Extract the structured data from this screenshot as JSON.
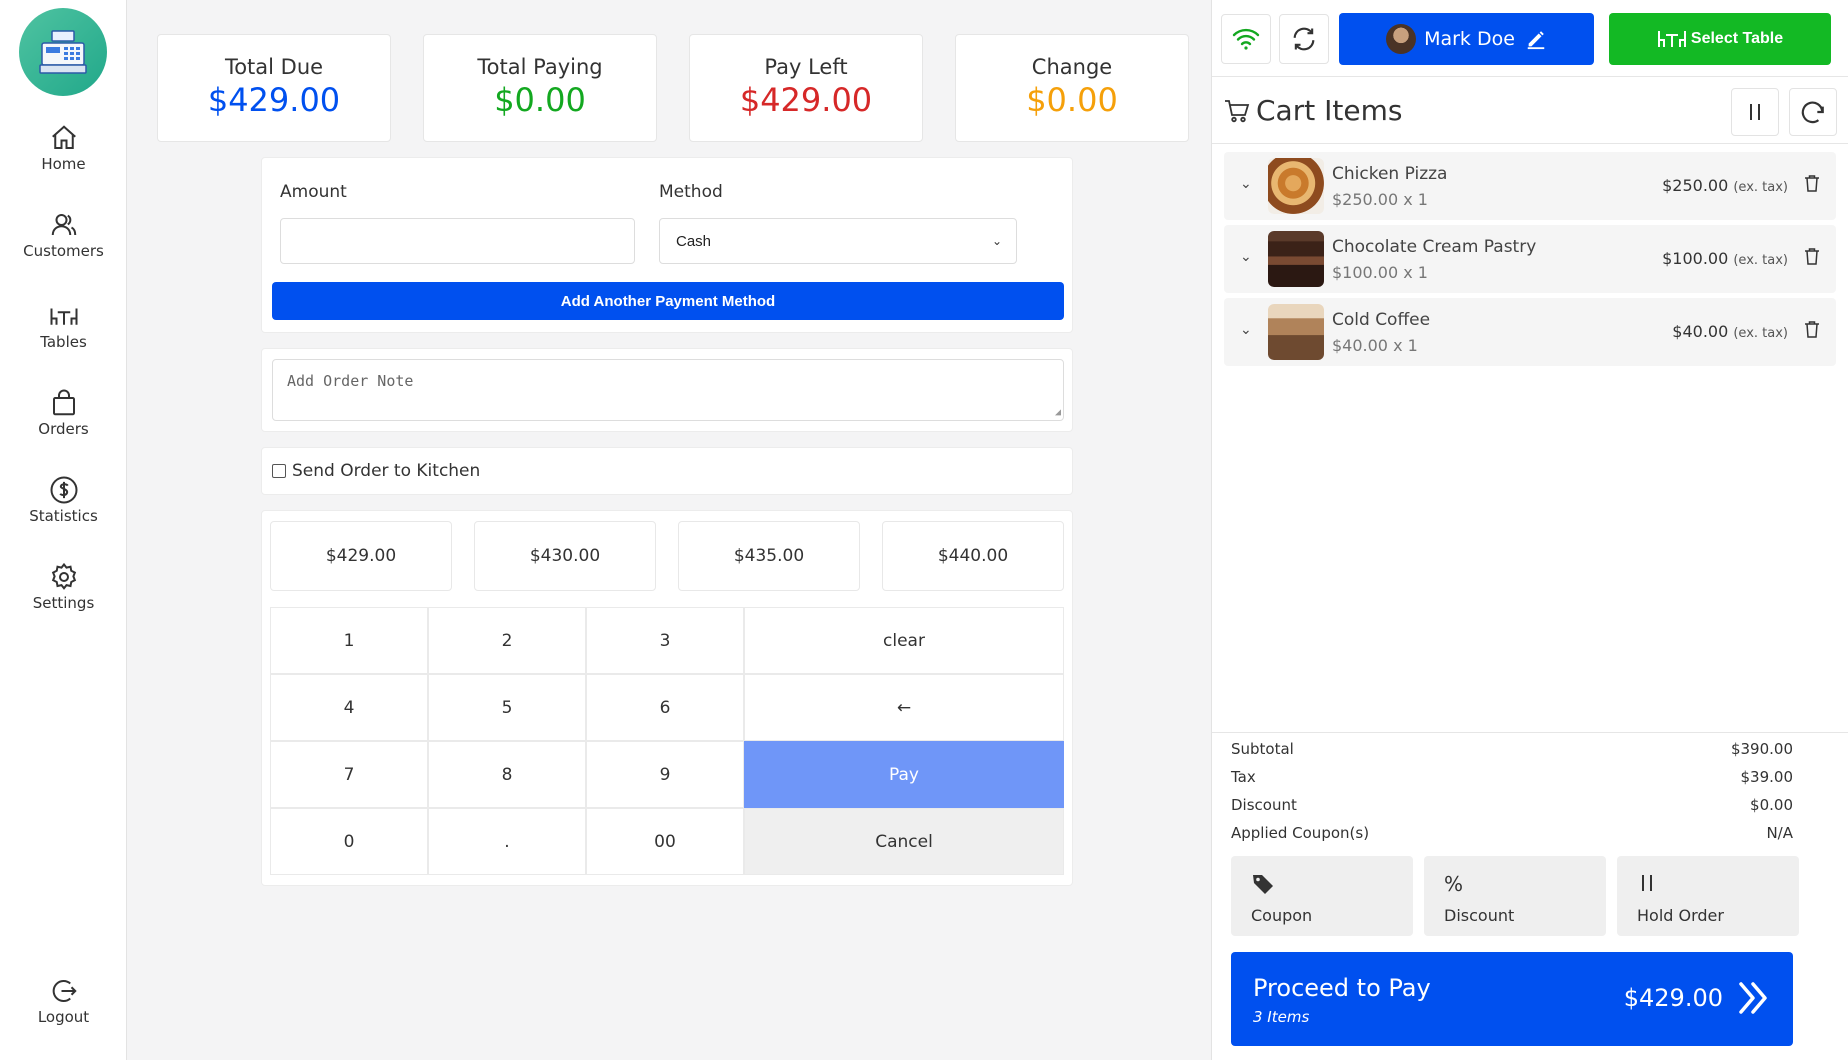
{
  "colors": {
    "blue": "#0050ef",
    "green": "#13b924",
    "red": "#e02424",
    "orange": "#f5a00a",
    "pay_key": "#6f96f8"
  },
  "sidebar": {
    "items": [
      {
        "label": "Home",
        "icon": "home-icon"
      },
      {
        "label": "Customers",
        "icon": "users-icon"
      },
      {
        "label": "Tables",
        "icon": "table-icon"
      },
      {
        "label": "Orders",
        "icon": "bag-icon"
      },
      {
        "label": "Statistics",
        "icon": "dollar-icon"
      },
      {
        "label": "Settings",
        "icon": "gear-icon"
      }
    ],
    "logout": "Logout"
  },
  "stats": {
    "total_due": {
      "label": "Total Due",
      "value": "$429.00"
    },
    "total_paying": {
      "label": "Total Paying",
      "value": "$0.00"
    },
    "pay_left": {
      "label": "Pay Left",
      "value": "$429.00"
    },
    "change": {
      "label": "Change",
      "value": "$0.00"
    }
  },
  "payment": {
    "amount_label": "Amount",
    "amount_value": "",
    "method_label": "Method",
    "method_value": "Cash",
    "add_method": "Add Another Payment Method"
  },
  "note": {
    "placeholder": "Add Order Note"
  },
  "kitchen": {
    "label": "Send Order to Kitchen",
    "checked": false
  },
  "quick_amounts": [
    "$429.00",
    "$430.00",
    "$435.00",
    "$440.00"
  ],
  "keypad": {
    "keys": [
      "1",
      "2",
      "3",
      "4",
      "5",
      "6",
      "7",
      "8",
      "9",
      "0",
      ".",
      "00"
    ],
    "clear": "clear",
    "backspace": "←",
    "pay": "Pay",
    "cancel": "Cancel"
  },
  "header": {
    "user": "Mark Doe",
    "select_table": "Select Table"
  },
  "cart": {
    "title": "Cart Items",
    "items": [
      {
        "name": "Chicken Pizza",
        "qty": "$250.00 x 1",
        "price": "$250.00",
        "tax_note": "(ex. tax)"
      },
      {
        "name": "Chocolate Cream Pastry",
        "qty": "$100.00 x 1",
        "price": "$100.00",
        "tax_note": "(ex. tax)"
      },
      {
        "name": "Cold Coffee",
        "qty": "$40.00 x 1",
        "price": "$40.00",
        "tax_note": "(ex. tax)"
      }
    ]
  },
  "summary": {
    "subtotal": {
      "label": "Subtotal",
      "value": "$390.00"
    },
    "tax": {
      "label": "Tax",
      "value": "$39.00"
    },
    "discount": {
      "label": "Discount",
      "value": "$0.00"
    },
    "coupons": {
      "label": "Applied Coupon(s)",
      "value": "N/A"
    }
  },
  "actions": {
    "coupon": "Coupon",
    "discount": "Discount",
    "hold": "Hold Order"
  },
  "proceed": {
    "label": "Proceed to Pay",
    "items": "3 Items",
    "amount": "$429.00"
  }
}
